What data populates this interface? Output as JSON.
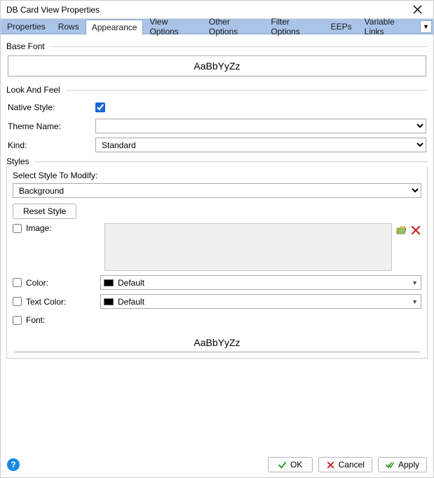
{
  "window": {
    "title": "DB Card View Properties"
  },
  "tabs": [
    "Properties",
    "Rows",
    "Appearance",
    "View Options",
    "Other Options",
    "Filter Options",
    "EEPs",
    "Variable Links"
  ],
  "active_tab": "Appearance",
  "basefont": {
    "label": "Base Font",
    "sample": "AaBbYyZz"
  },
  "lookfeel": {
    "label": "Look And Feel",
    "native_label": "Native Style:",
    "native_checked": true,
    "theme_label": "Theme Name:",
    "theme_value": "",
    "kind_label": "Kind:",
    "kind_value": "Standard"
  },
  "styles": {
    "label": "Styles",
    "select_label": "Select Style To Modify:",
    "select_value": "Background",
    "reset_label": "Reset Style",
    "image_label": "Image:",
    "image_checked": false,
    "color_label": "Color:",
    "color_checked": false,
    "color_value": "Default",
    "textcolor_label": "Text Color:",
    "textcolor_checked": false,
    "textcolor_value": "Default",
    "font_label": "Font:",
    "font_checked": false,
    "sample": "AaBbYyZz"
  },
  "footer": {
    "ok": "OK",
    "cancel": "Cancel",
    "apply": "Apply"
  }
}
